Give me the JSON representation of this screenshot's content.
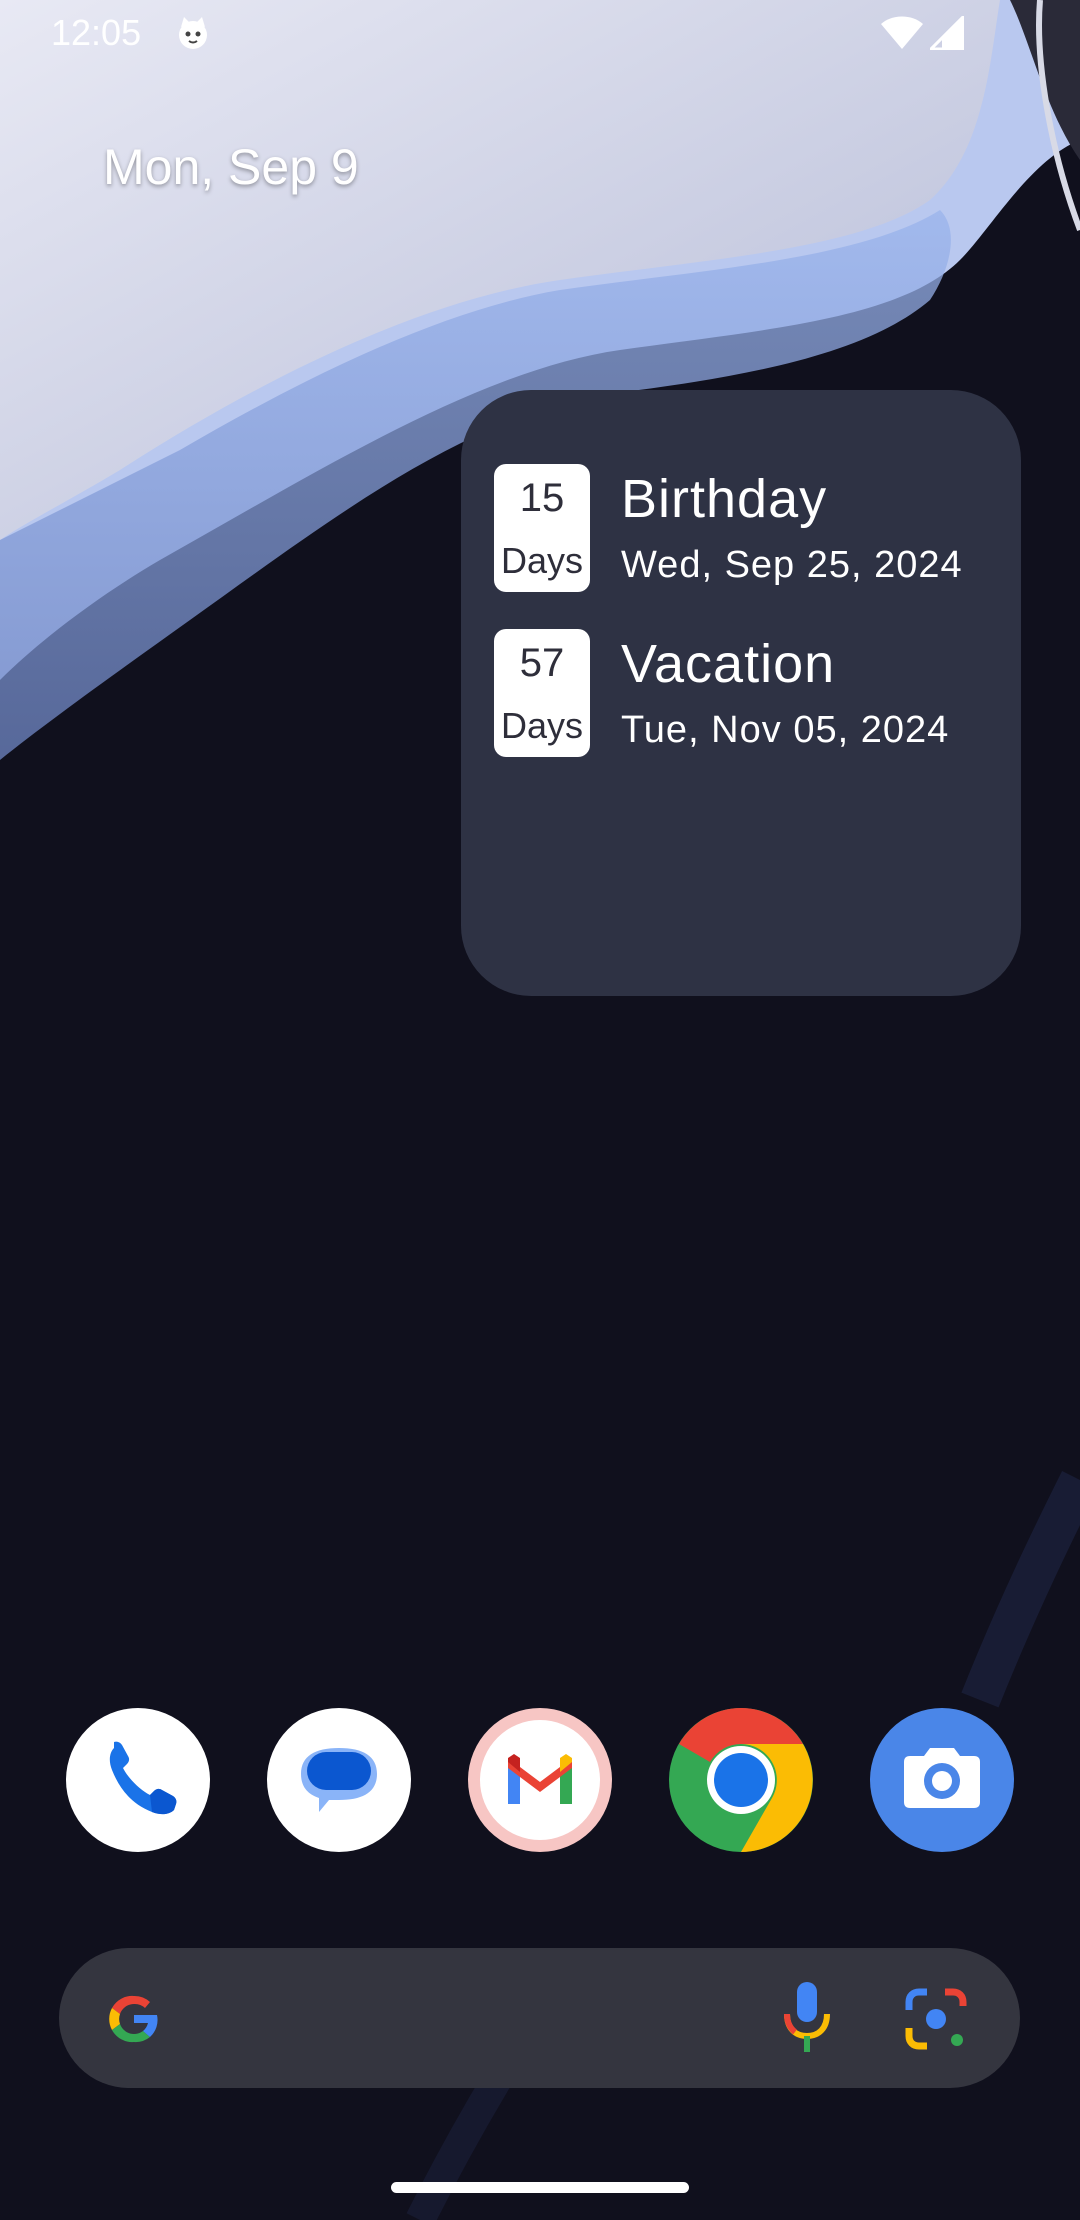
{
  "status_bar": {
    "time": "12:05",
    "icons": [
      "cat-face-icon",
      "wifi-icon",
      "cell-signal-icon"
    ]
  },
  "home": {
    "date": "Mon, Sep 9"
  },
  "countdown_widget": {
    "events": [
      {
        "days": "15",
        "unit": "Days",
        "title": "Birthday",
        "date": "Wed, Sep 25, 2024"
      },
      {
        "days": "57",
        "unit": "Days",
        "title": "Vacation",
        "date": "Tue, Nov 05, 2024"
      }
    ],
    "background_color": "#2e3244"
  },
  "dock": {
    "apps": [
      "phone-app-icon",
      "messages-app-icon",
      "gmail-app-icon",
      "chrome-app-icon",
      "camera-app-icon"
    ]
  },
  "search_bar": {
    "icons": [
      "google-g-icon",
      "microphone-icon",
      "google-lens-icon"
    ],
    "background_color": "#34353f"
  }
}
